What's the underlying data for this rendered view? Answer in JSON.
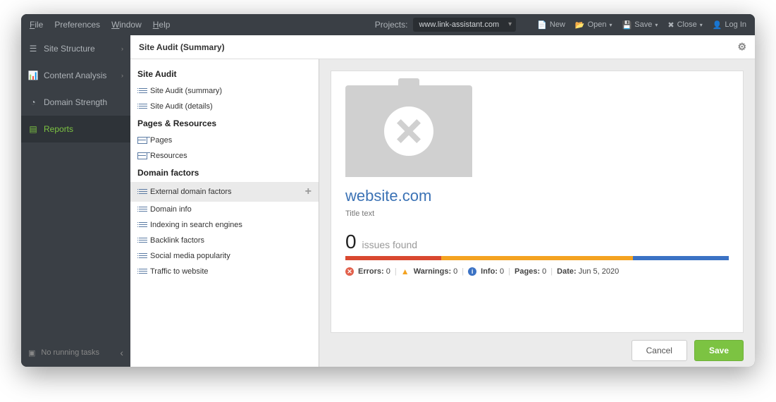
{
  "menubar": {
    "file": "File",
    "preferences": "Preferences",
    "window": "Window",
    "help": "Help",
    "projects_label": "Projects:",
    "project_value": "www.link-assistant.com",
    "new": "New",
    "open": "Open",
    "save": "Save",
    "close": "Close",
    "login": "Log In"
  },
  "sidebar": {
    "items": [
      {
        "label": "Site Structure"
      },
      {
        "label": "Content Analysis"
      },
      {
        "label": "Domain Strength"
      },
      {
        "label": "Reports"
      }
    ],
    "footer": "No running tasks"
  },
  "header": {
    "title": "Site Audit (Summary)"
  },
  "sections": {
    "site_audit": {
      "title": "Site Audit",
      "items": [
        "Site Audit (summary)",
        "Site Audit (details)"
      ]
    },
    "pages_resources": {
      "title": "Pages & Resources",
      "items": [
        "Pages",
        "Resources"
      ]
    },
    "domain_factors": {
      "title": "Domain factors",
      "items": [
        "External domain factors",
        "Domain info",
        "Indexing in search engines",
        "Backlink factors",
        "Social media popularity",
        "Traffic to website"
      ]
    }
  },
  "card": {
    "domain": "website.com",
    "title_text": "Title text",
    "issues_count": "0",
    "issues_label": "issues found",
    "errors_label": "Errors:",
    "errors_val": "0",
    "warnings_label": "Warnings:",
    "warnings_val": "0",
    "info_label": "Info:",
    "info_val": "0",
    "pages_label": "Pages:",
    "pages_val": "0",
    "date_label": "Date:",
    "date_val": "Jun 5, 2020"
  },
  "buttons": {
    "cancel": "Cancel",
    "save": "Save"
  }
}
